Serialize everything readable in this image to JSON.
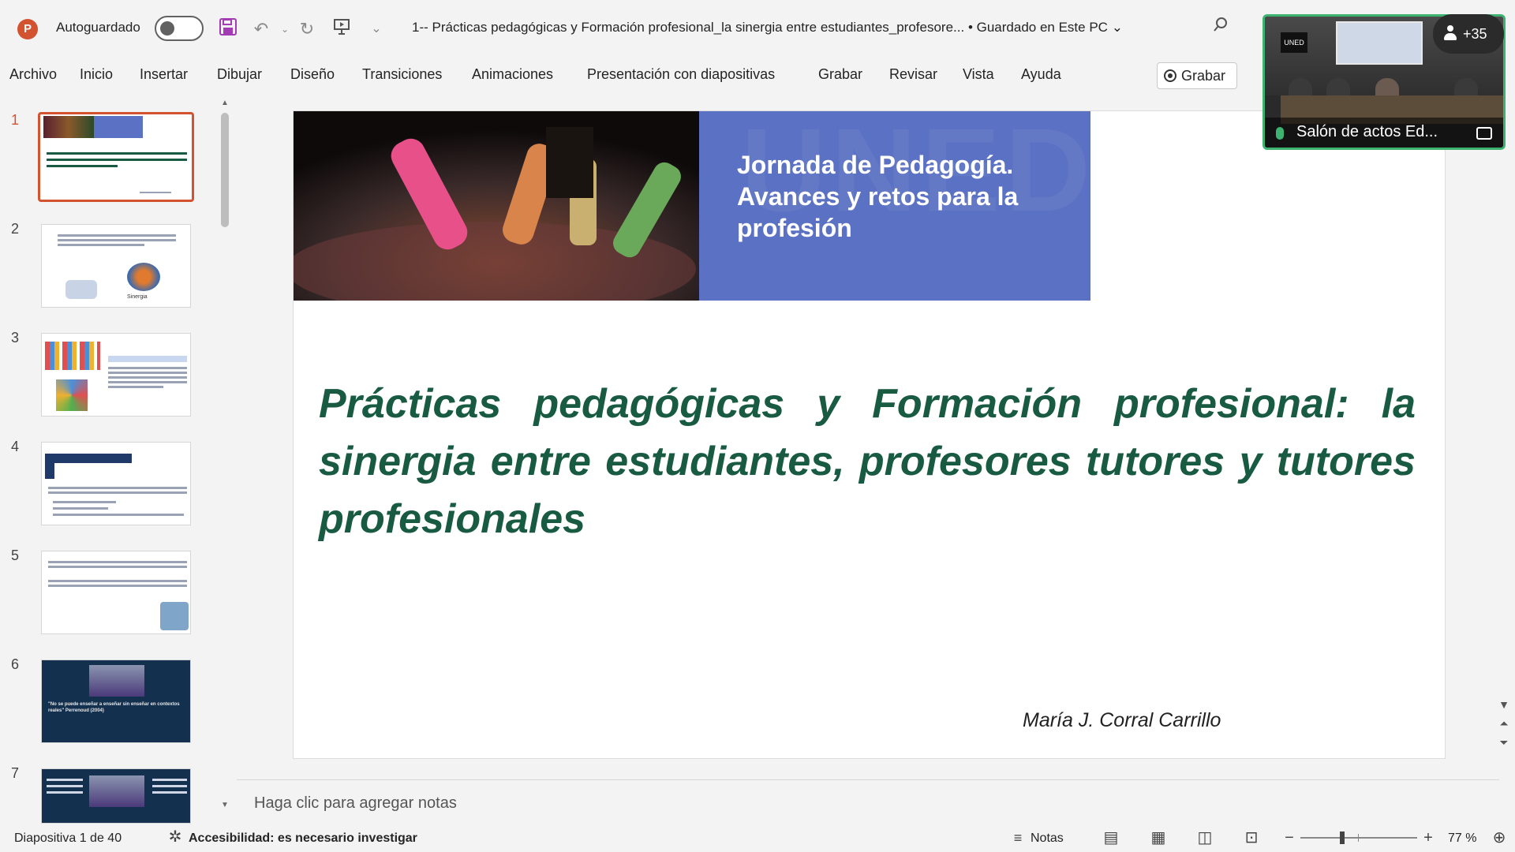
{
  "titlebar": {
    "app_icon": "powerpoint-icon",
    "autosave_label": "Autoguardado",
    "autosave_on": false,
    "document_title": "1-- Prácticas pedagógicas y Formación profesional_la sinergia entre estudiantes_profesore...",
    "save_status": "•  Guardado en Este PC",
    "chevron": "⌄"
  },
  "menu": {
    "items": [
      "Archivo",
      "Inicio",
      "Insertar",
      "Dibujar",
      "Diseño",
      "Transiciones",
      "Animaciones",
      "Presentación con diapositivas",
      "Grabar",
      "Revisar",
      "Vista",
      "Ayuda"
    ],
    "record_button": "Grabar"
  },
  "thumbnails": {
    "numbers": [
      "1",
      "2",
      "3",
      "4",
      "5",
      "6",
      "7"
    ],
    "selected": 1,
    "slide2_caption": "Sinergia",
    "slide6_quote": "\"No se puede enseñar a enseñar sin enseñar en contextos reales\" Perrenoud (2004)"
  },
  "slide": {
    "banner_text": "Jornada de Pedagogía. Avances y retos para la profesión",
    "title": "Prácticas pedagógicas y Formación profesional: la sinergia entre estudiantes, profesores tutores y tutores profesionales",
    "author": "María J. Corral Carrillo",
    "colors": {
      "title": "#185a42",
      "banner_blue": "#5b71c3",
      "selection": "#d35230"
    }
  },
  "notes": {
    "placeholder": "Haga clic para agregar notas"
  },
  "video": {
    "caption": "Salón de actos Ed...",
    "participants": "+35",
    "logo_text": "UNED"
  },
  "status": {
    "slide_counter": "Diapositiva 1 de 40",
    "accessibility": "Accesibilidad: es necesario investigar",
    "notes_label": "Notas",
    "zoom_percent": "77 %",
    "zoom_value": 77
  }
}
